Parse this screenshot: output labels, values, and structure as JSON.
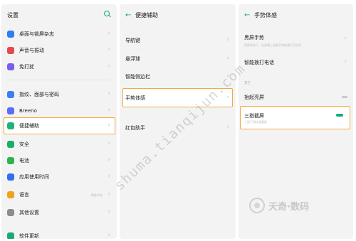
{
  "panel1": {
    "title": "设置",
    "items": [
      {
        "label": "桌面与锁屏杂志",
        "icon": "desktop-icon",
        "color": "#2f7df2"
      },
      {
        "label": "声音与振动",
        "icon": "sound-icon",
        "color": "#e5484d"
      },
      {
        "label": "免打扰",
        "icon": "moon-icon",
        "color": "#7b5cf0"
      },
      {
        "label": "指纹、面部与密码",
        "icon": "fingerprint-icon",
        "color": "#3a7ff6"
      },
      {
        "label": "Breeno",
        "icon": "breeno-icon",
        "color": "#5b6cf5"
      },
      {
        "label": "便捷辅助",
        "icon": "assist-icon",
        "color": "#21b07b"
      },
      {
        "label": "安全",
        "icon": "shield-icon",
        "color": "#18b063"
      },
      {
        "label": "电池",
        "icon": "battery-icon",
        "color": "#2db34a"
      },
      {
        "label": "应用使用时间",
        "icon": "screen-time-icon",
        "color": "#2f6ff2"
      },
      {
        "label": "语言",
        "icon": "language-icon",
        "color": "#f0a21b",
        "value": "简体中文"
      },
      {
        "label": "其他设置",
        "icon": "more-settings-icon",
        "color": "#8c8c8c"
      },
      {
        "label": "软件更新",
        "icon": "update-icon",
        "color": "#1aa87a"
      }
    ]
  },
  "panel2": {
    "title": "便捷辅助",
    "items": [
      {
        "label": "导航键"
      },
      {
        "label": "悬浮球"
      },
      {
        "label": "智能侧边栏"
      },
      {
        "label": "手势体感"
      },
      {
        "label": "红包助手"
      }
    ]
  },
  "panel3": {
    "title": "手势体感",
    "items": [
      {
        "label": "黑屏手势",
        "desc": "黑屏状态下，在屏幕上绘制手势快速打开应用"
      },
      {
        "label": "智能拨打电话"
      }
    ],
    "section": "其它",
    "toggles": [
      {
        "label": "抬起亮屏",
        "on": false
      },
      {
        "label": "三指截屏",
        "desc": "三指下滑快速截屏",
        "on": true
      }
    ]
  },
  "watermark": "shuma.tianqijun.com",
  "logo_text": "天奇·数码",
  "colors": {
    "accent": "#1aa87a",
    "highlight": "#f3a93c"
  }
}
